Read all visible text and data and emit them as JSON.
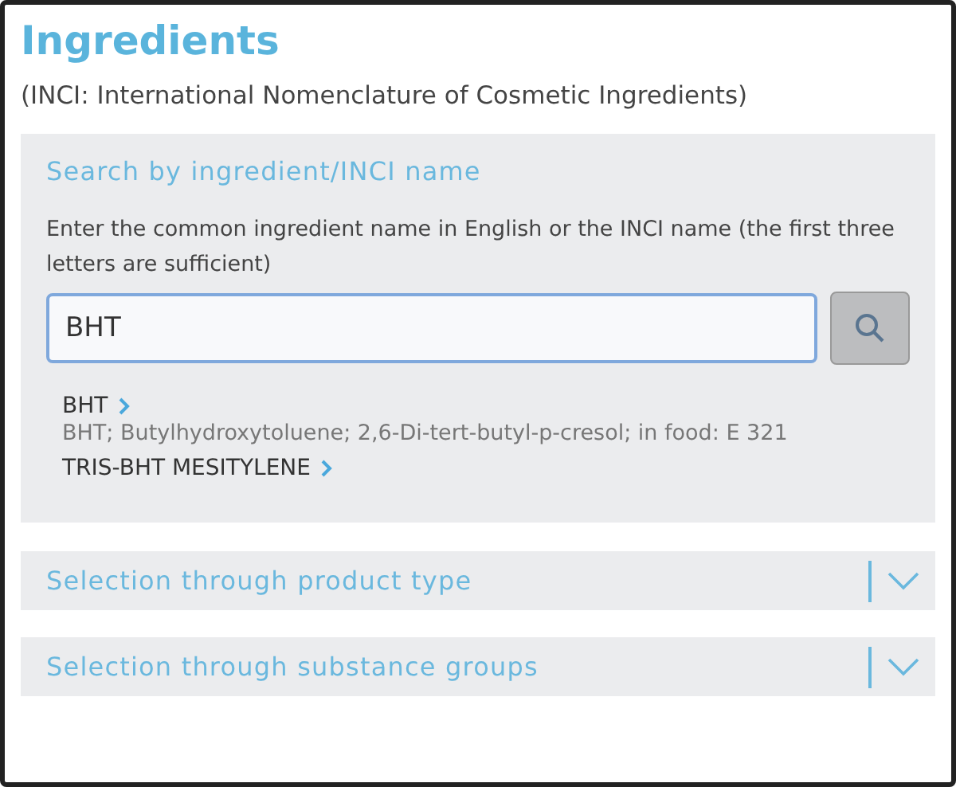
{
  "title": "Ingredients",
  "subtitle": "(INCI: International Nomenclature of Cosmetic Ingredients)",
  "search_panel": {
    "heading": "Search by ingredient/INCI name",
    "instructions": "Enter the common ingredient name in English or the INCI name (the first three letters are sufficient)",
    "field": {
      "value": "BHT"
    },
    "results": [
      {
        "name": "BHT",
        "detail": "BHT; Butylhydroxytoluene; 2,6-Di-tert-butyl-p-cresol; in food: E 321"
      },
      {
        "name": "TRIS-BHT MESITYLENE"
      }
    ]
  },
  "sections": [
    {
      "label": "Selection through product type",
      "expanded": false
    },
    {
      "label": "Selection through substance groups",
      "expanded": false
    }
  ]
}
